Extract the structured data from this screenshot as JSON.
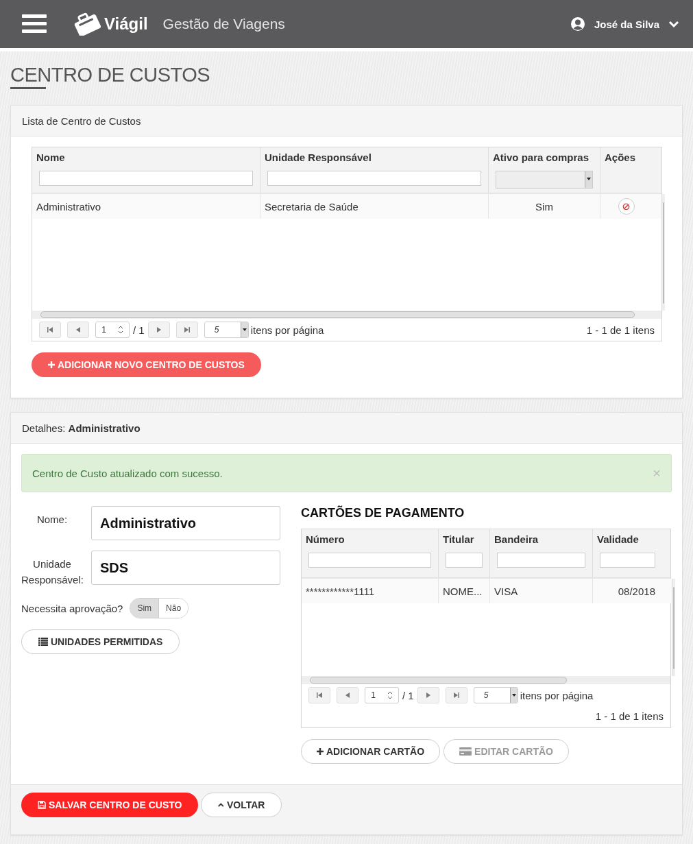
{
  "header": {
    "brand": "Viágil",
    "subtitle": "Gestão de Viagens",
    "user": "José da Silva"
  },
  "page_title": "CENTRO DE CUSTOS",
  "list_panel": {
    "title": "Lista de Centro de Custos",
    "grid": {
      "columns": [
        {
          "label": "Nome",
          "kind": "text_filter"
        },
        {
          "label": "Unidade Responsável",
          "kind": "text_filter"
        },
        {
          "label": "Ativo para compras",
          "kind": "select_filter"
        },
        {
          "label": "Ações",
          "kind": "actions"
        }
      ],
      "rows": [
        {
          "cells": [
            "Administrativo",
            "Secretaria de Saúde",
            "Sim"
          ]
        }
      ],
      "pager": {
        "page": "1",
        "total": "/ 1",
        "page_size": "5",
        "per_page": "itens por página",
        "summary": "1 - 1 de 1 itens"
      }
    },
    "add_button": "ADICIONAR NOVO CENTRO DE CUSTOS"
  },
  "details_panel": {
    "title_prefix": "Detalhes:",
    "title_value": "Administrativo",
    "alert": {
      "message": "Centro de Custo atualizado com sucesso.",
      "close": "×"
    },
    "fields": [
      {
        "label": "Nome:",
        "value": "Administrativo"
      },
      {
        "label": "Unidade Responsável:",
        "value": "SDS"
      }
    ],
    "approval": {
      "label": "Necessita aprovação?",
      "options": [
        {
          "label": "Sim",
          "selected": true
        },
        {
          "label": "Não",
          "selected": false
        }
      ]
    },
    "units_button": "UNIDADES PERMITIDAS",
    "cards": {
      "heading": "CARTÕES DE PAGAMENTO",
      "grid": {
        "columns": [
          {
            "label": "Número",
            "kind": "text_filter"
          },
          {
            "label": "Titular",
            "kind": "text_filter"
          },
          {
            "label": "Bandeira",
            "kind": "text_filter"
          },
          {
            "label": "Validade",
            "kind": "text_filter"
          }
        ],
        "rows": [
          {
            "cells": [
              "************1111",
              "NOME...",
              "VISA",
              "08/2018"
            ]
          }
        ],
        "pager": {
          "page": "1",
          "total": "/ 1",
          "page_size": "5",
          "per_page": "itens por página",
          "summary": "1 - 1 de 1 itens"
        }
      },
      "buttons": [
        {
          "kind": "add",
          "label": "ADICIONAR CARTÃO",
          "disabled": false
        },
        {
          "kind": "edit",
          "label": "EDITAR CARTÃO",
          "disabled": true
        }
      ]
    }
  },
  "footer_buttons": [
    {
      "kind": "save",
      "label": "SALVAR CENTRO DE CUSTO"
    },
    {
      "kind": "back",
      "label": "VOLTAR"
    }
  ]
}
